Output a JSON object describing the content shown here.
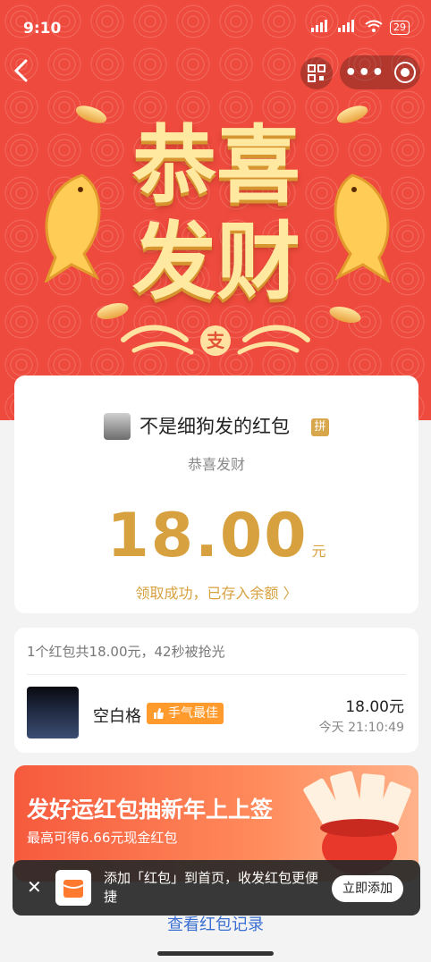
{
  "status_bar": {
    "time": "9:10",
    "network_1": "HD",
    "network_2": "HD",
    "battery": "29"
  },
  "nav": {
    "back_icon": "chevron-left-icon",
    "scan_icon": "scan-icon",
    "more_icon": "more-dots-icon",
    "target_icon": "target-icon"
  },
  "hero": {
    "title": "恭喜发财",
    "badge_char": "支",
    "color": "#ee4a3d"
  },
  "main_card": {
    "sender": "不是细狗发的红包",
    "tag": "拼",
    "greeting": "恭喜发财",
    "amount": "18.00",
    "unit": "元",
    "success": "领取成功，已存入余额 〉"
  },
  "records_card": {
    "summary": "1个红包共18.00元，42秒被抢光",
    "items": [
      {
        "name": "空白格",
        "badge": "手气最佳",
        "amount": "18.00元",
        "time": "今天 21:10:49"
      }
    ]
  },
  "banner": {
    "title": "发好运红包抽新年上上签",
    "subtitle": "最高可得6.66元现金红包"
  },
  "toast": {
    "text": "添加「红包」到首页，收发红包更便捷",
    "button": "立即添加",
    "close_icon": "close-icon"
  },
  "footer": {
    "link": "查看红包记录"
  }
}
